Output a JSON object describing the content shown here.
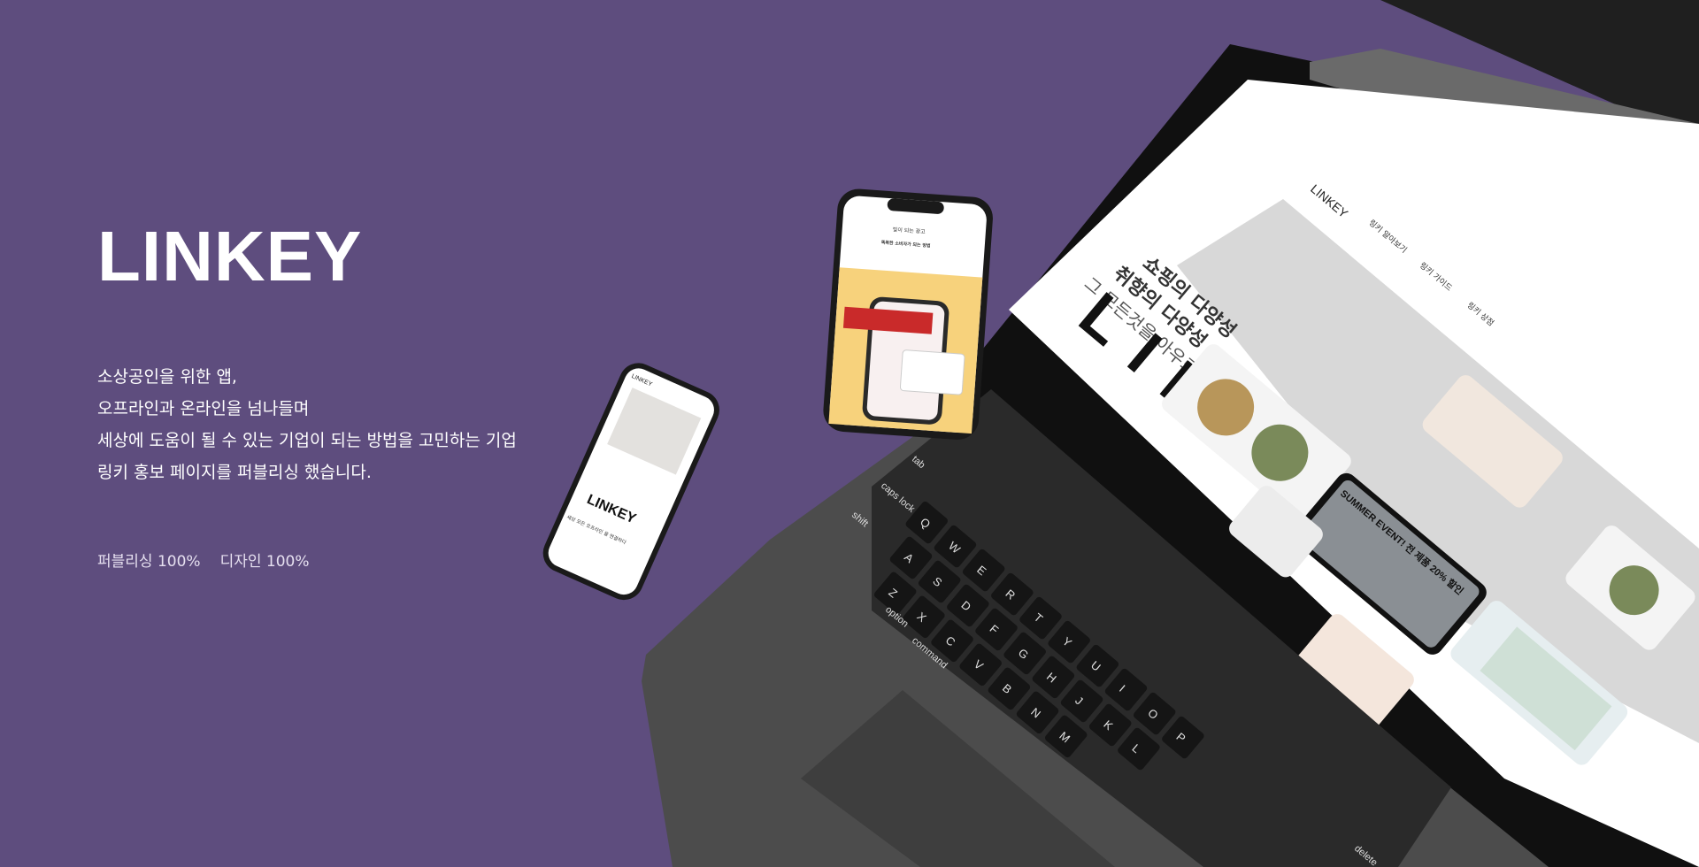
{
  "hero": {
    "title": "LINKEY",
    "description_lines": [
      "소상공인을 위한 앱,",
      "오프라인과 온라인을 넘나들며",
      "세상에 도움이 될 수 있는 기업이 되는 방법을 고민하는 기업",
      "링키 홍보 페이지를 퍼블리싱 했습니다."
    ],
    "stats": [
      "퍼블리싱 100%",
      "디자인 100%"
    ]
  },
  "laptop_screen": {
    "logo": "LINKEY",
    "nav": [
      "링키 알아보기",
      "링키 가이드",
      "링키 상점"
    ],
    "headline": [
      "쇼핑의 다양성",
      "취향의 다양성",
      "그 모든것을 아우르는"
    ],
    "big_text": "LINKEY",
    "event_text": "SUMMER EVENT! 전 제품 20% 할인"
  },
  "phone_back": {
    "title": "빛이 되는 광고",
    "subtitle": "똑똑한 소비자가 되는 방법"
  },
  "phone_front": {
    "logo": "LINKEY",
    "big_text": "LINKEY",
    "sub": "세상 모든 오프라인 을 연결하다"
  },
  "keyboard_keys": [
    "tab",
    "caps lock",
    "shift",
    "option",
    "command",
    "Q",
    "W",
    "E",
    "R",
    "T",
    "Y",
    "U",
    "I",
    "O",
    "P",
    "A",
    "S",
    "D",
    "F",
    "G",
    "H",
    "J",
    "K",
    "L",
    "Z",
    "X",
    "C",
    "V",
    "B",
    "N",
    "M",
    "delete"
  ],
  "colors": {
    "background": "#5e4d7e",
    "text": "#ffffff",
    "laptop": "#4a4a4a",
    "keys": "#151515"
  }
}
